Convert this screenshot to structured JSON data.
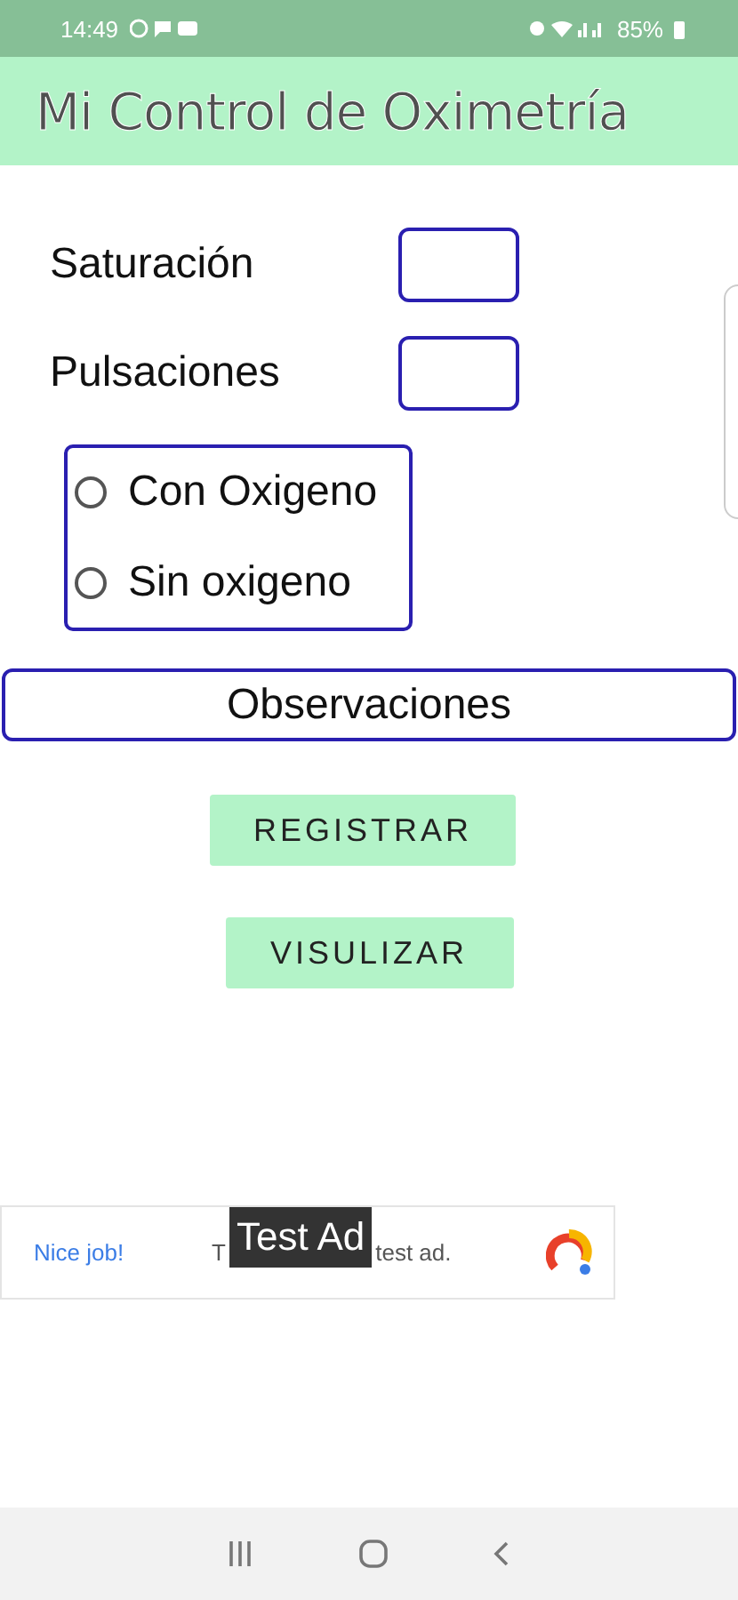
{
  "status_bar": {
    "time": "14:49",
    "battery": "85%"
  },
  "app_bar": {
    "title": "Mi Control de Oximetría"
  },
  "fields": [
    {
      "label": "Saturación"
    },
    {
      "label": "Pulsaciones"
    }
  ],
  "oxygen_options": [
    {
      "label": "Con Oxigeno",
      "selected": false
    },
    {
      "label": "Sin oxigeno",
      "selected": false
    }
  ],
  "observations": {
    "placeholder": "Observaciones"
  },
  "buttons": [
    {
      "label": "REGISTRAR"
    },
    {
      "label": "VISULIZAR"
    }
  ],
  "ad": {
    "headline": "Nice job!",
    "text_start": "T",
    "text_end": "test ad.",
    "overlay": "Test Ad"
  }
}
